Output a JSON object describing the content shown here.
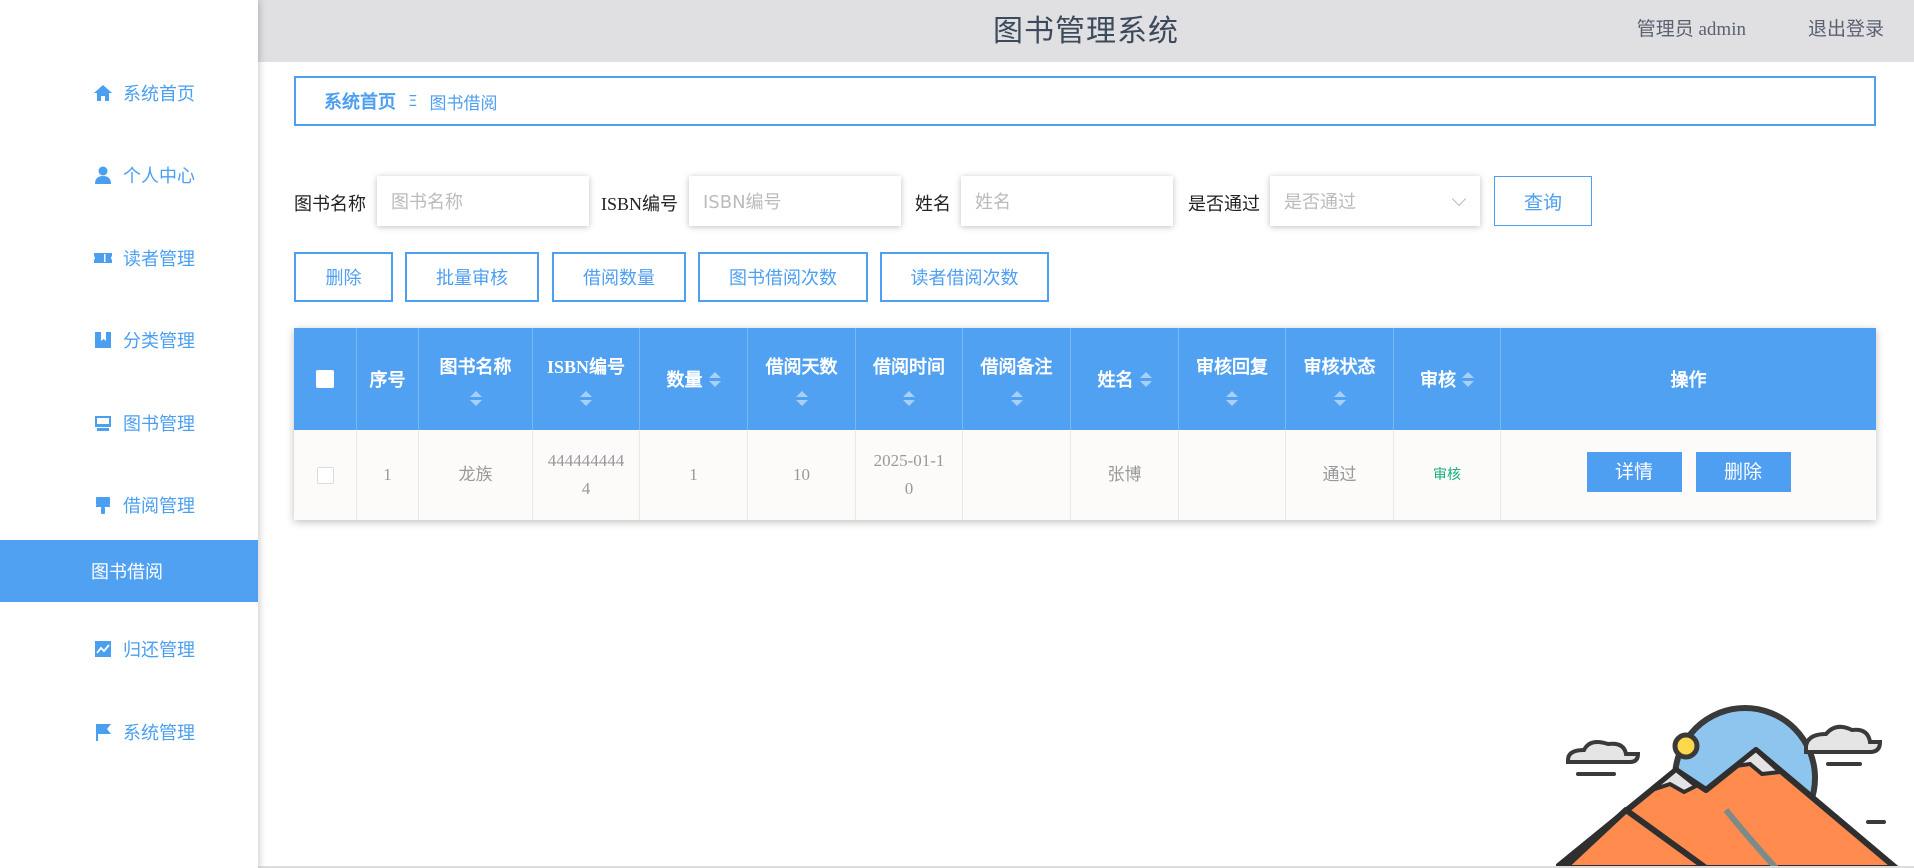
{
  "header": {
    "title": "图书管理系统",
    "user": "管理员 admin",
    "logout": "退出登录"
  },
  "sidebar": {
    "items": [
      {
        "label": "系统首页",
        "icon": "home-icon"
      },
      {
        "label": "个人中心",
        "icon": "user-icon"
      },
      {
        "label": "读者管理",
        "icon": "ticket-icon"
      },
      {
        "label": "分类管理",
        "icon": "bookmark-icon"
      },
      {
        "label": "图书管理",
        "icon": "inbox-icon"
      },
      {
        "label": "借阅管理",
        "icon": "brush-icon"
      },
      {
        "label": "图书借阅",
        "icon": ""
      },
      {
        "label": "归还管理",
        "icon": "chart-icon"
      },
      {
        "label": "系统管理",
        "icon": "flag-icon"
      }
    ],
    "accent": "#51a1f3"
  },
  "breadcrumb": {
    "home": "系统首页",
    "separator": "Ξ",
    "current": "图书借阅"
  },
  "search": {
    "book_name_label": "图书名称",
    "book_name_placeholder": "图书名称",
    "isbn_label": "ISBN编号",
    "isbn_placeholder": "ISBN编号",
    "name_label": "姓名",
    "name_placeholder": "姓名",
    "passed_label": "是否通过",
    "passed_placeholder": "是否通过",
    "query_label": "查询"
  },
  "actions": {
    "delete": "删除",
    "batch_audit": "批量审核",
    "borrow_count": "借阅数量",
    "book_borrow_times": "图书借阅次数",
    "reader_borrow_times": "读者借阅次数"
  },
  "table": {
    "headers": {
      "index": "序号",
      "book_name": "图书名称",
      "isbn": "ISBN编号",
      "quantity": "数量",
      "borrow_days": "借阅天数",
      "borrow_time": "借阅时间",
      "borrow_note": "借阅备注",
      "name": "姓名",
      "audit_reply": "审核回复",
      "audit_status": "审核状态",
      "audit": "审核",
      "operation": "操作"
    },
    "rows": [
      {
        "index": "1",
        "book_name": "龙族",
        "isbn_line1": "444444444",
        "isbn_line2": "4",
        "quantity": "1",
        "borrow_days": "10",
        "borrow_time_line1": "2025-01-1",
        "borrow_time_line2": "0",
        "borrow_note": "",
        "name": "张博",
        "audit_reply": "",
        "audit_status": "通过",
        "audit_link": "审核",
        "detail_btn": "详情",
        "delete_btn": "删除"
      }
    ]
  }
}
